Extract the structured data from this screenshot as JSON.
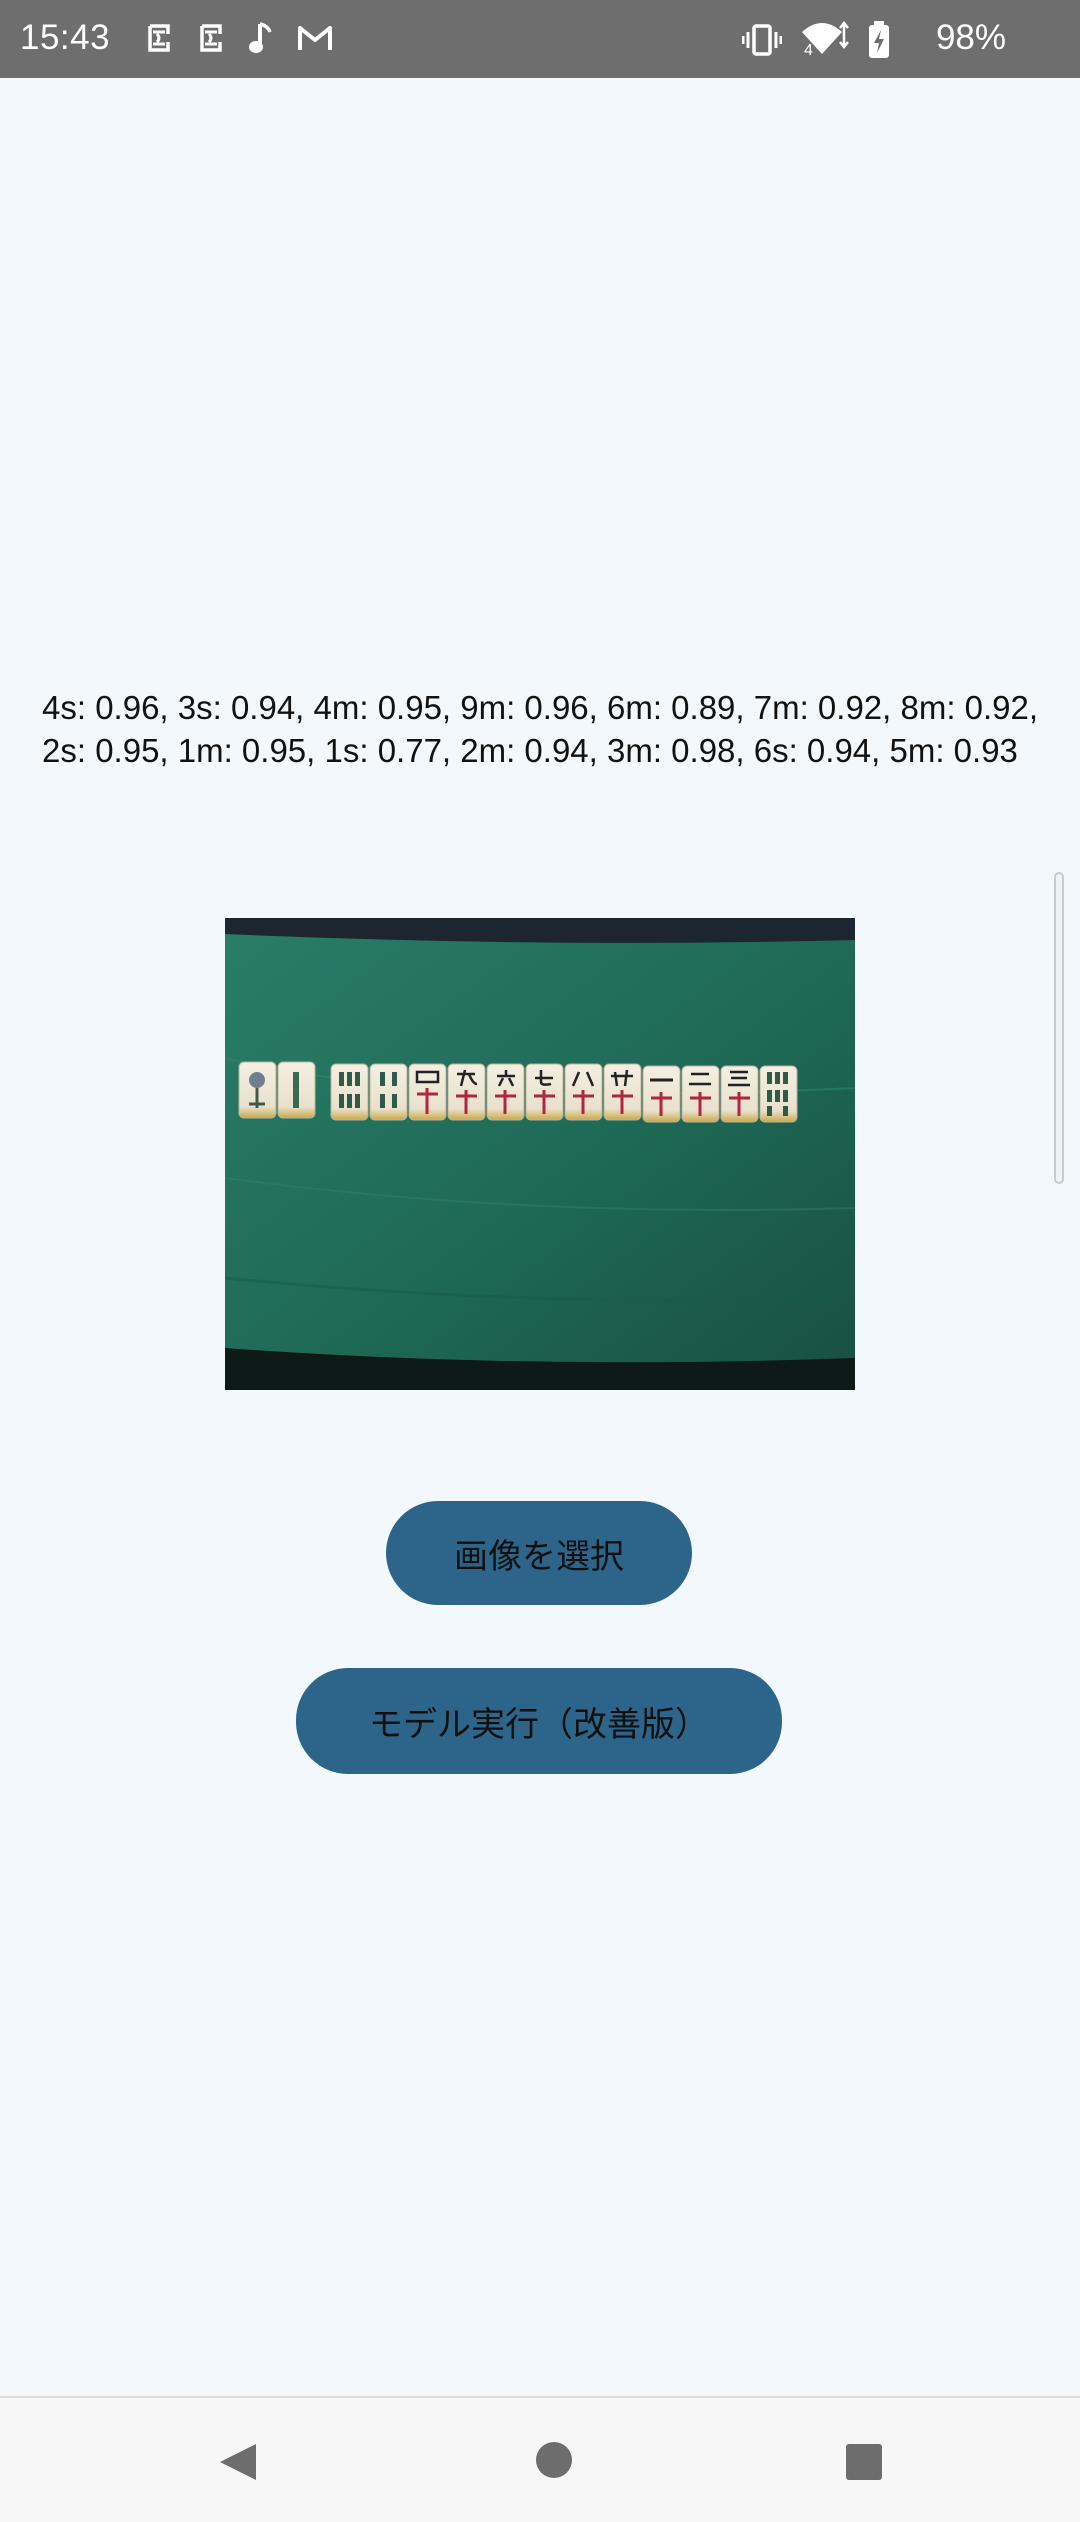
{
  "status_bar": {
    "time": "15:43",
    "battery": "98%",
    "network_label": "4",
    "left_icons": [
      "notification-app-icon",
      "notification-app-icon",
      "music-note-icon",
      "gmail-icon"
    ],
    "right_icons": [
      "vibrate-icon",
      "wifi-icon",
      "battery-charging-icon"
    ]
  },
  "main": {
    "results": "4s: 0.96, 3s: 0.94, 4m: 0.95, 9m: 0.96, 6m: 0.89, 7m: 0.92, 8m: 0.92, 2s: 0.95, 1m: 0.95, 1s: 0.77, 2m: 0.94, 3m: 0.98, 6s: 0.94, 5m: 0.93",
    "select_image_label": "画像を選択",
    "run_model_label": "モデル実行（改善版）"
  },
  "nav_bar": {
    "icons": [
      "back-icon",
      "home-icon",
      "recents-icon"
    ]
  },
  "colors": {
    "background": "#f2f8fb",
    "status_bar": "#6e6e6e",
    "button": "#2c6589",
    "mat": "#1f6b58"
  }
}
